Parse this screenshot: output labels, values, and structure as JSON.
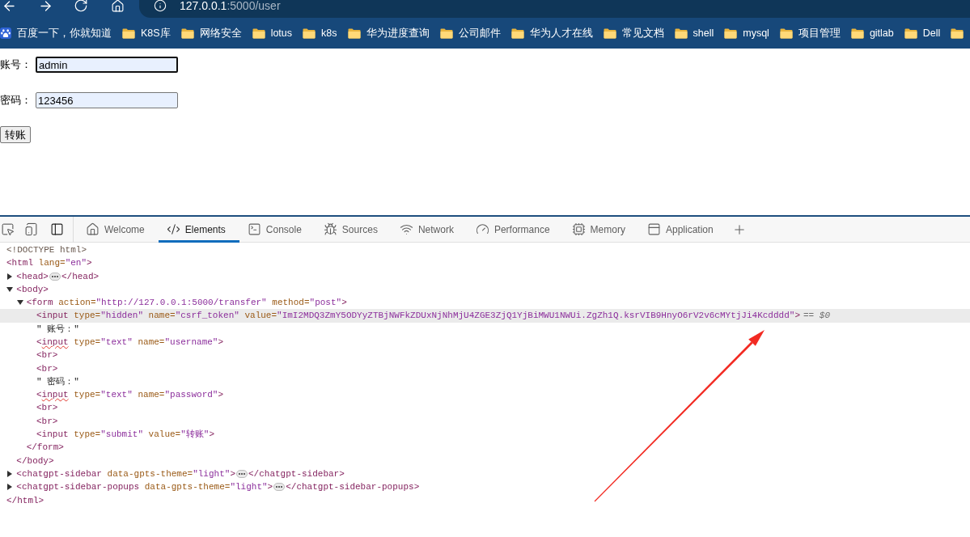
{
  "browser": {
    "address": {
      "host": "127.0.0.1",
      "path": ":5000/user"
    },
    "bookmarks": [
      {
        "kind": "site",
        "label": "百度一下，你就知道"
      },
      {
        "kind": "folder",
        "label": "K8S库"
      },
      {
        "kind": "folder",
        "label": "网络安全"
      },
      {
        "kind": "folder",
        "label": "lotus"
      },
      {
        "kind": "folder",
        "label": "k8s"
      },
      {
        "kind": "folder",
        "label": "华为进度查询"
      },
      {
        "kind": "folder",
        "label": "公司邮件"
      },
      {
        "kind": "folder",
        "label": "华为人才在线"
      },
      {
        "kind": "folder",
        "label": "常见文档"
      },
      {
        "kind": "folder",
        "label": "shell"
      },
      {
        "kind": "folder",
        "label": "mysql"
      },
      {
        "kind": "folder",
        "label": "项目管理"
      },
      {
        "kind": "folder",
        "label": "gitlab"
      },
      {
        "kind": "folder",
        "label": "Dell"
      },
      {
        "kind": "folder"
      }
    ]
  },
  "page": {
    "fields": [
      {
        "label": "账号：",
        "value": "admin",
        "focused": true
      },
      {
        "label": "密码：",
        "value": "123456",
        "focused": false
      }
    ],
    "submit_button": "转账"
  },
  "devtools": {
    "tabs": [
      {
        "kind": "welcome",
        "label": "Welcome",
        "selected": false
      },
      {
        "kind": "elements",
        "label": "Elements",
        "selected": true
      },
      {
        "kind": "console",
        "label": "Console",
        "selected": false
      },
      {
        "kind": "sources",
        "label": "Sources",
        "selected": false
      },
      {
        "kind": "network",
        "label": "Network",
        "selected": false
      },
      {
        "kind": "performance",
        "label": "Performance",
        "selected": false
      },
      {
        "kind": "memory",
        "label": "Memory",
        "selected": false
      },
      {
        "kind": "application",
        "label": "Application",
        "selected": false
      }
    ],
    "dom_tree": [
      {
        "selected": false,
        "tokens": [
          {
            "kind": "doctype",
            "text": "<!DOCTYPE html>"
          }
        ]
      },
      {
        "selected": false,
        "tokens": [
          {
            "kind": "tag",
            "text": "<html"
          },
          {
            "kind": "attr",
            "text": " lang="
          },
          {
            "kind": "value",
            "text": "\"en\""
          },
          {
            "kind": "tag",
            "text": ">"
          }
        ],
        "children": [
          {
            "selected": false,
            "expanded": false,
            "tokens": [
              {
                "kind": "tag",
                "text": "<head>"
              },
              {
                "kind": "collapsed"
              },
              {
                "kind": "tag",
                "text": "</head>"
              }
            ]
          },
          {
            "selected": false,
            "expanded": true,
            "tokens": [
              {
                "kind": "tag",
                "text": "<body>"
              }
            ],
            "children": [
              {
                "selected": false,
                "expanded": true,
                "tokens": [
                  {
                    "kind": "tag",
                    "text": "<form"
                  },
                  {
                    "kind": "attr",
                    "text": " action="
                  },
                  {
                    "kind": "value",
                    "text": "\"http://127.0.0.1:5000/transfer\""
                  },
                  {
                    "kind": "attr",
                    "text": " method="
                  },
                  {
                    "kind": "value",
                    "text": "\"post\""
                  },
                  {
                    "kind": "tag",
                    "text": ">"
                  }
                ],
                "children": [
                  {
                    "selected": true,
                    "note": "== $0",
                    "tokens": [
                      {
                        "kind": "tag",
                        "text": "<input"
                      },
                      {
                        "kind": "attr",
                        "text": " type="
                      },
                      {
                        "kind": "value",
                        "text": "\"hidden\""
                      },
                      {
                        "kind": "attr",
                        "text": " name="
                      },
                      {
                        "kind": "value",
                        "text": "\"csrf_token\""
                      },
                      {
                        "kind": "attr",
                        "text": " value="
                      },
                      {
                        "kind": "value",
                        "text": "\"ImI2MDQ3ZmY5ODYyZTBjNWFkZDUxNjNhMjU4ZGE3ZjQ1YjBiMWU1NWUi.ZgZh1Q.ksrVIB9HnyO6rV2v6cMYtjJi4Kcdddd\""
                      },
                      {
                        "kind": "tag",
                        "text": ">"
                      }
                    ]
                  },
                  {
                    "selected": false,
                    "tokens": [
                      {
                        "kind": "text",
                        "text": "\" 账号：\""
                      }
                    ]
                  },
                  {
                    "selected": false,
                    "tokens": [
                      {
                        "kind": "tag",
                        "text": "<"
                      },
                      {
                        "kind": "misspelled_tag",
                        "text": "input"
                      },
                      {
                        "kind": "attr",
                        "text": " type="
                      },
                      {
                        "kind": "value",
                        "text": "\"text\""
                      },
                      {
                        "kind": "attr",
                        "text": " name="
                      },
                      {
                        "kind": "value",
                        "text": "\"username\""
                      },
                      {
                        "kind": "tag",
                        "text": ">"
                      }
                    ]
                  },
                  {
                    "selected": false,
                    "tokens": [
                      {
                        "kind": "tag",
                        "text": "<br>"
                      }
                    ]
                  },
                  {
                    "selected": false,
                    "tokens": [
                      {
                        "kind": "tag",
                        "text": "<br>"
                      }
                    ]
                  },
                  {
                    "selected": false,
                    "tokens": [
                      {
                        "kind": "text",
                        "text": "\" 密码：\""
                      }
                    ]
                  },
                  {
                    "selected": false,
                    "tokens": [
                      {
                        "kind": "tag",
                        "text": "<"
                      },
                      {
                        "kind": "misspelled_tag",
                        "text": "input"
                      },
                      {
                        "kind": "attr",
                        "text": " type="
                      },
                      {
                        "kind": "value",
                        "text": "\"text\""
                      },
                      {
                        "kind": "attr",
                        "text": " name="
                      },
                      {
                        "kind": "value",
                        "text": "\"password\""
                      },
                      {
                        "kind": "tag",
                        "text": ">"
                      }
                    ]
                  },
                  {
                    "selected": false,
                    "tokens": [
                      {
                        "kind": "tag",
                        "text": "<br>"
                      }
                    ]
                  },
                  {
                    "selected": false,
                    "tokens": [
                      {
                        "kind": "tag",
                        "text": "<br>"
                      }
                    ]
                  },
                  {
                    "selected": false,
                    "tokens": [
                      {
                        "kind": "tag",
                        "text": "<input"
                      },
                      {
                        "kind": "attr",
                        "text": " type="
                      },
                      {
                        "kind": "value",
                        "text": "\"submit\""
                      },
                      {
                        "kind": "attr",
                        "text": " value="
                      },
                      {
                        "kind": "value",
                        "text": "\"转账\""
                      },
                      {
                        "kind": "tag",
                        "text": ">"
                      }
                    ]
                  }
                ],
                "closing": [
                  {
                    "kind": "tag",
                    "text": "</form>"
                  }
                ]
              }
            ],
            "closing": [
              {
                "kind": "tag",
                "text": "</body>"
              }
            ]
          },
          {
            "selected": false,
            "expanded": false,
            "tokens": [
              {
                "kind": "tag",
                "text": "<chatgpt-sidebar"
              },
              {
                "kind": "attr",
                "text": " data-gpts-theme="
              },
              {
                "kind": "value",
                "text": "\"light\""
              },
              {
                "kind": "tag",
                "text": ">"
              },
              {
                "kind": "collapsed"
              },
              {
                "kind": "tag",
                "text": "</chatgpt-sidebar>"
              }
            ]
          },
          {
            "selected": false,
            "expanded": false,
            "tokens": [
              {
                "kind": "tag",
                "text": "<chatgpt-sidebar-popups"
              },
              {
                "kind": "attr",
                "text": " data-gpts-theme="
              },
              {
                "kind": "value",
                "text": "\"light\""
              },
              {
                "kind": "tag",
                "text": ">"
              },
              {
                "kind": "collapsed"
              },
              {
                "kind": "tag",
                "text": "</chatgpt-sidebar-popups>"
              }
            ]
          }
        ],
        "closing": [
          {
            "kind": "tag",
            "text": "</html>"
          }
        ]
      }
    ]
  }
}
